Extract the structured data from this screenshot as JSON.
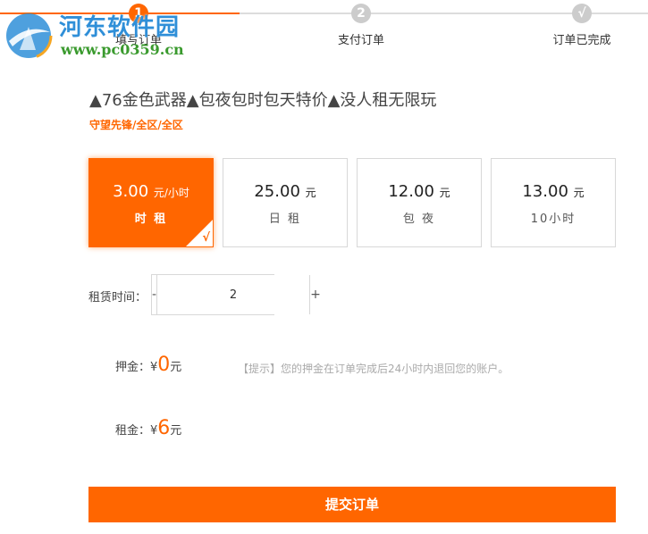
{
  "watermark": {
    "title": "河东软件园",
    "url": "www.pc0359.cn"
  },
  "stepper": {
    "steps": [
      {
        "number": "1",
        "label": "填写订单"
      },
      {
        "number": "2",
        "label": "支付订单"
      },
      {
        "number": "√",
        "label": "订单已完成"
      }
    ]
  },
  "product": {
    "title": "▲76金色武器▲包夜包时包天特价▲没人租无限玩",
    "subtitle": "守望先锋/全区/全区"
  },
  "options": [
    {
      "price": "3.00",
      "unit": "元/小时",
      "label": "时 租",
      "selected": true
    },
    {
      "price": "25.00",
      "unit": "元",
      "label": "日 租",
      "selected": false
    },
    {
      "price": "12.00",
      "unit": "元",
      "label": "包 夜",
      "selected": false
    },
    {
      "price": "13.00",
      "unit": "元",
      "label": "10小时",
      "selected": false
    }
  ],
  "check_mark": "√",
  "rental_time": {
    "label": "租赁时间：",
    "minus": "-",
    "plus": "+",
    "value": "2"
  },
  "deposit": {
    "label": "押金：",
    "currency": "¥",
    "amount": "0",
    "unit": "元"
  },
  "hint": "【提示】您的押金在订单完成后24小时内退回您的账户。",
  "rent": {
    "label": "租金：",
    "currency": "¥",
    "amount": "6",
    "unit": "元"
  },
  "submit_label": "提交订单",
  "colors": {
    "accent": "#ff6600",
    "inactive_step": "#cccccc"
  }
}
